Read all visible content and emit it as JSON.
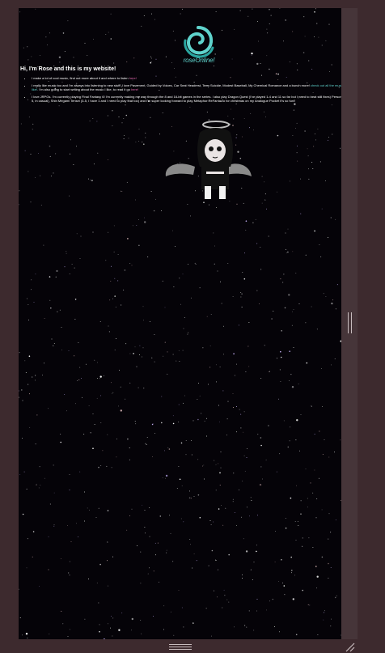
{
  "site": {
    "logo_text": "roseOnline!",
    "heading": "Hi, I'm Rose and this is my website!"
  },
  "bullets": [
    {
      "pre": "I make a lot of cool music, find out more about it and where to listen ",
      "link": "here!",
      "post": ""
    },
    {
      "pre": "I really like music too and I'm always into listening to new stuff! I love Pavement, Guided by Voices, Car Seat Headrest, Teen Suicide, Modest Baseball, My Chemical Romance and a bunch more! ",
      "link": "check out all the music I like!",
      "post": ". I'm also going to start writing about the music I like, to read it go ",
      "link2": "here!"
    },
    {
      "pre": "I love JRPGs. I'm currently playing Final Fantasy 6! I'm currently making my way through the 8 and 16-bit games in the series. I also play Dragon Quest (I've played 1-4 and 11 so far but I need to beat still fixes) Persona (3-5, in casual), Shin Megami Tensei (3-5, I have 1 and I need to play that too) and I'm super looking forward to play Metaphor:ReFantazio for christmas on my Analogue Pocket it's so fun!!",
      "link": "",
      "post": ""
    }
  ],
  "colors": {
    "background": "#3d2a2e",
    "frame": "#050308",
    "accent": "#5fd3cc",
    "link_pink": "#e56bb0"
  },
  "icons": {
    "logo": "swirl-logo-icon",
    "avatar": "angel-avatar-icon",
    "scroll_handle": "scroll-grip-icon",
    "resize": "resize-grip-icon"
  }
}
